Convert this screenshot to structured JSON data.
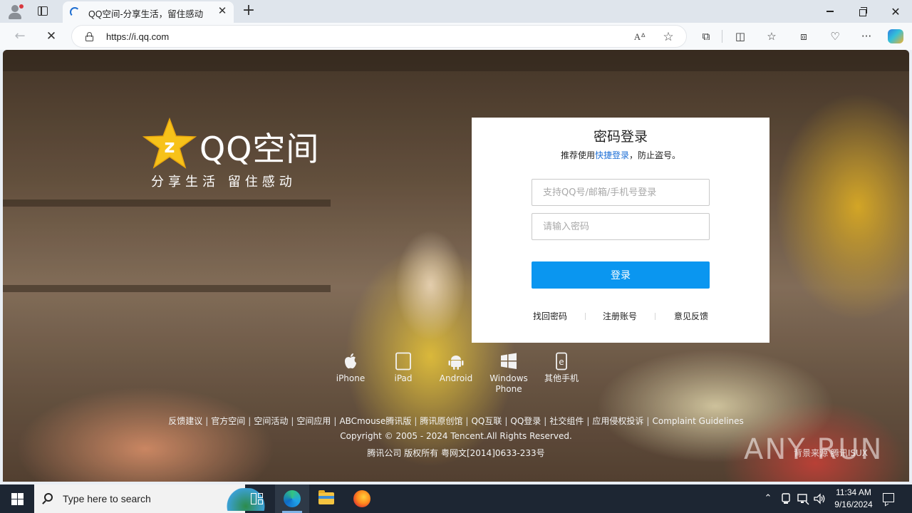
{
  "browser": {
    "tab": {
      "title": "QQ空间-分享生活，留住感动",
      "close_glyph": "✕"
    },
    "new_tab_glyph": "+",
    "window": {
      "close_glyph": "✕"
    },
    "toolbar": {
      "back_glyph": "←",
      "stop_glyph": "✕",
      "url": "https://i.qq.com",
      "read_aloud_glyph": "Aᐞ",
      "favorite_glyph": "☆",
      "extensions_glyph": "⧉",
      "split_glyph": "◫",
      "favorites_glyph": "☆",
      "collections_glyph": "⧈",
      "browser_essentials_glyph": "♡",
      "more_glyph": "···"
    },
    "icons": [
      "profile-icon",
      "tab-actions-icon",
      "loading-icon",
      "lock-icon",
      "read-aloud-icon",
      "star-icon",
      "extensions-icon",
      "split-screen-icon",
      "favorites-icon",
      "collections-icon",
      "heart-icon",
      "more-icon",
      "copilot-icon"
    ]
  },
  "page": {
    "logo": {
      "text": "QQ空间",
      "slogan": "分享生活 留住感动",
      "star_color": "#f7c21a"
    },
    "login": {
      "title": "密码登录",
      "tip_prefix": "推荐使用",
      "tip_link": "快捷登录",
      "tip_suffix": "，防止盗号。",
      "username_placeholder": "支持QQ号/邮箱/手机号登录",
      "password_placeholder": "请输入密码",
      "submit_label": "登录",
      "links": [
        "找回密码",
        "注册账号",
        "意见反馈"
      ],
      "button_color": "#0a96f0"
    },
    "platforms": [
      {
        "label": "iPhone",
        "icon": "apple-icon"
      },
      {
        "label": "iPad",
        "icon": "tablet-icon"
      },
      {
        "label": "Android",
        "icon": "android-icon"
      },
      {
        "label": "Windows Phone",
        "icon": "windows-icon"
      },
      {
        "label": "其他手机",
        "icon": "other-phone-icon"
      }
    ],
    "footer": {
      "links": [
        "反馈建议",
        "官方空间",
        "空间活动",
        "空间应用",
        "ABCmouse腾讯版",
        "腾讯原创馆",
        "QQ互联",
        "QQ登录",
        "社交组件",
        "应用侵权投诉",
        "Complaint Guidelines"
      ],
      "separator": "|",
      "copyright": "Copyright © 2005 - 2024 Tencent.All Rights Reserved.",
      "icp": "腾讯公司 版权所有 粤网文[2014]0633-233号",
      "bg_credit": "背景来源  腾讯ISUX"
    },
    "watermark": "ANY RUN"
  },
  "taskbar": {
    "search_placeholder": "Type here to search",
    "apps": [
      "task-view-icon",
      "edge-icon",
      "file-explorer-icon",
      "firefox-icon"
    ],
    "tray": {
      "chevron": "⌃",
      "time": "11:34 AM",
      "date": "9/16/2024"
    }
  }
}
